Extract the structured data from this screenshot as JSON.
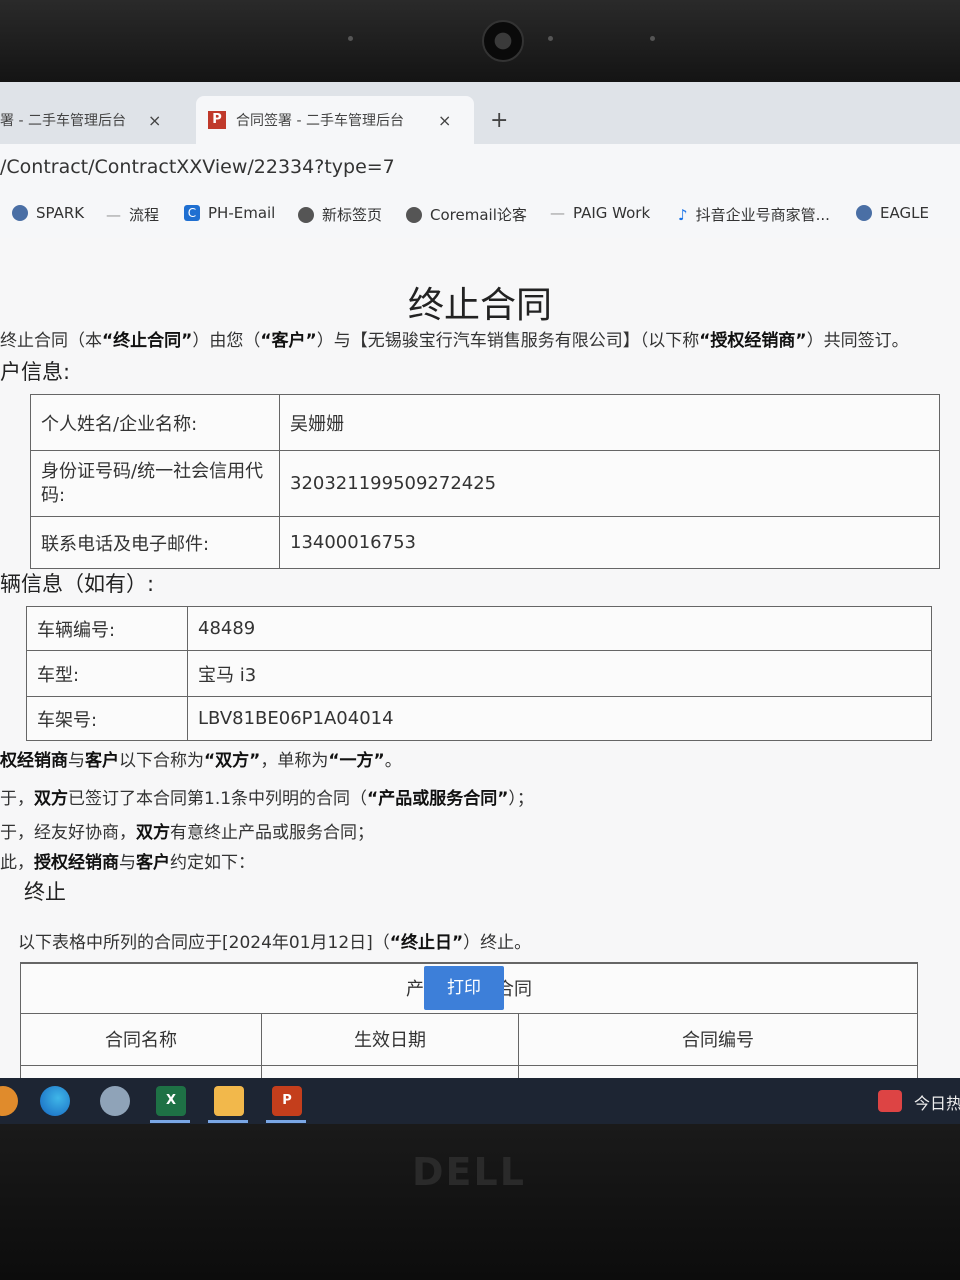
{
  "browser": {
    "tabs": [
      {
        "title": "署 - 二手车管理后台",
        "close": "×"
      },
      {
        "icon_letter": "P",
        "title": "合同签署 - 二手车管理后台",
        "close": "×"
      }
    ],
    "new_tab": "+",
    "url": "/Contract/ContractXXView/22334?type=7",
    "bookmarks": [
      {
        "label": "SPARK",
        "icon": "globe-icon"
      },
      {
        "label": "流程",
        "icon": "dash-icon"
      },
      {
        "label": "PH-Email",
        "icon": "c-icon"
      },
      {
        "label": "新标签页",
        "icon": "globe-icon"
      },
      {
        "label": "Coremail论客",
        "icon": "globe-icon"
      },
      {
        "label": "PAIG Work",
        "icon": "dash-icon"
      },
      {
        "label": "抖音企业号商家管...",
        "icon": "douyin-icon"
      },
      {
        "label": "EAGLE",
        "icon": "globe-icon"
      }
    ]
  },
  "doc": {
    "title": "终止合同",
    "intro": [
      "终止合同（本",
      "“终止合同”",
      "）由您（",
      "“客户”",
      "）与【无锡骏宝行汽车销售服务有限公司】（以下称",
      "“授权经销商”",
      "）共同签订。"
    ],
    "customer_heading": "户信息:",
    "customer_rows": [
      {
        "label": "个人姓名/企业名称:",
        "value": "吴姗姗"
      },
      {
        "label": "身份证号码/统一社会信用代码:",
        "value": "320321199509272425"
      },
      {
        "label": "联系电话及电子邮件:",
        "value": "13400016753"
      }
    ],
    "vehicle_heading": "辆信息（如有）:",
    "vehicle_rows": [
      {
        "label": "车辆编号:",
        "value": "48489"
      },
      {
        "label": "车型:",
        "value": "宝马 i3"
      },
      {
        "label": "车架号:",
        "value": "LBV81BE06P1A04014"
      }
    ],
    "clause_1": [
      "权经销商",
      "与",
      "客户",
      "以下合称为",
      "“双方”",
      "，单称为",
      "“一方”",
      "。"
    ],
    "clause_2": [
      "于，",
      "双方",
      "已签订了本合同第1.1条中列明的合同（",
      "“产品或服务合同”",
      "）；"
    ],
    "clause_3": [
      "于，经友好协商，",
      "双方",
      "有意终止产品或服务合同；"
    ],
    "clause_4": [
      "此，",
      "授权经销商",
      "与",
      "客户",
      "约定如下："
    ],
    "termination_heading": "终止",
    "termination_text": [
      "以下表格中所列的合同应于[2024年01月12日]（",
      "“终止日”",
      "）终止。"
    ],
    "contract_table": {
      "caption": "产品或服务合同",
      "headers": [
        "合同名称",
        "生效日期",
        "合同编号"
      ]
    },
    "print_button": "打印"
  },
  "taskbar": {
    "apps": [
      "edge-icon",
      "app-icon",
      "excel-icon",
      "file-explorer-icon",
      "powerpoint-icon"
    ],
    "tray_text": "今日热"
  },
  "bezel": {
    "brand": "DELL"
  }
}
